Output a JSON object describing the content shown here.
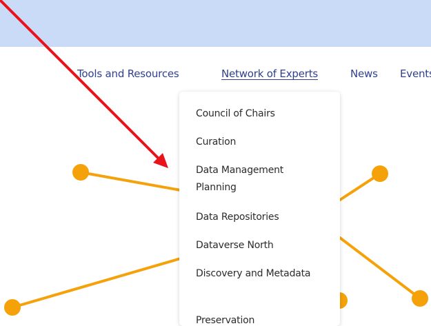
{
  "nav": {
    "items": [
      "Tools and Resources",
      "Network of Experts",
      "News",
      "Events"
    ],
    "active_index": 1
  },
  "dropdown": {
    "items": [
      "Council of Chairs",
      "Curation",
      "Data Management Planning",
      "Data Repositories",
      "Dataverse North",
      "Discovery and Metadata",
      "Preservation"
    ]
  },
  "colors": {
    "banner": "#c9dbf6",
    "nav_text": "#2f3f8f",
    "deco_orange": "#f5a20a",
    "annotation_arrow": "#e8141c"
  }
}
